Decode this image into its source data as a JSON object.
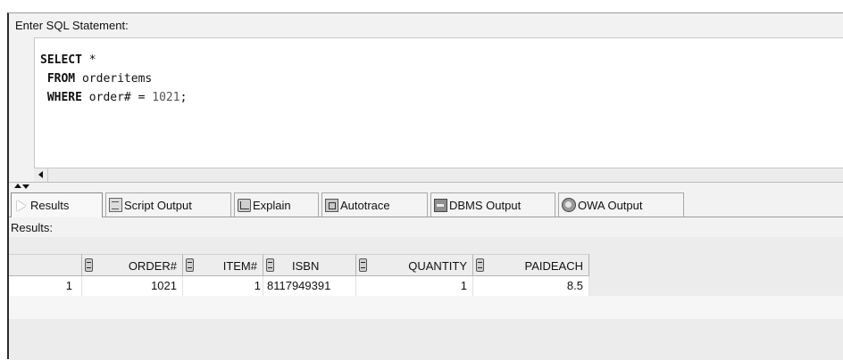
{
  "sql_editor": {
    "label": "Enter SQL Statement:",
    "lines": [
      {
        "kw": "SELECT",
        "rest": " *"
      },
      {
        "kw": "FROM",
        "rest": " orderitems"
      },
      {
        "kw": "WHERE",
        "rest": " order# = ",
        "num": "1021",
        "end": ";"
      }
    ]
  },
  "tabs": [
    {
      "label": "Results",
      "icon": "play-icon"
    },
    {
      "label": "Script Output",
      "icon": "script-icon"
    },
    {
      "label": "Explain",
      "icon": "explain-icon"
    },
    {
      "label": "Autotrace",
      "icon": "autotrace-icon"
    },
    {
      "label": "DBMS Output",
      "icon": "dbms-icon"
    },
    {
      "label": "OWA Output",
      "icon": "owa-icon"
    }
  ],
  "results": {
    "label": "Results:",
    "columns": [
      "ORDER#",
      "ITEM#",
      "ISBN",
      "QUANTITY",
      "PAIDEACH"
    ],
    "rows": [
      {
        "row_num": "1",
        "cells": [
          "1021",
          "1",
          "8117949391",
          "1",
          "8.5"
        ]
      }
    ]
  }
}
